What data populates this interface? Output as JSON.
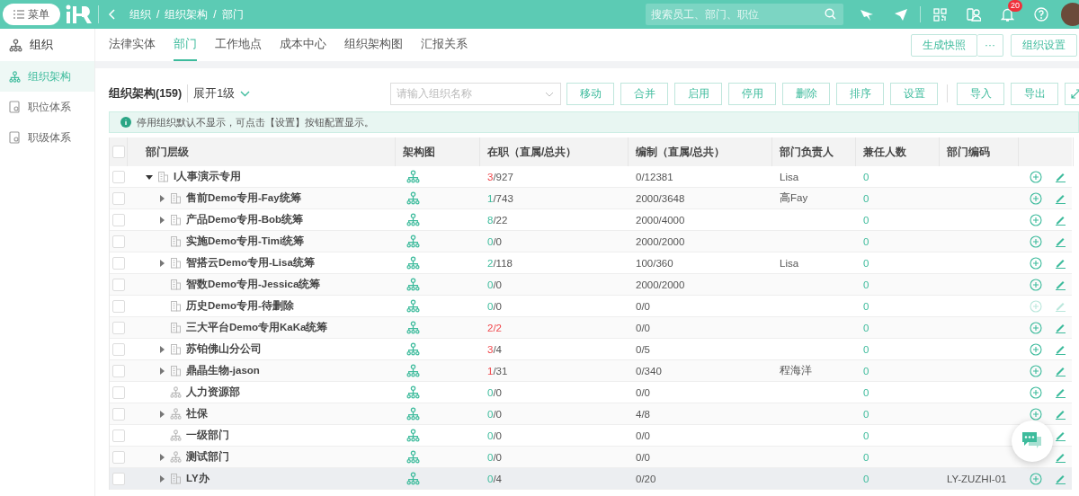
{
  "topbar": {
    "menu_label": "菜单",
    "breadcrumb": [
      "组织",
      "组织架构",
      "部门"
    ],
    "breadcrumb_separator": "/",
    "search": {
      "placeholder": "搜索员工、部门、职位"
    },
    "notification_count": "20"
  },
  "sidebar": {
    "title": "组织",
    "items": [
      {
        "label": "组织架构",
        "selected": true
      },
      {
        "label": "职位体系",
        "selected": false
      },
      {
        "label": "职级体系",
        "selected": false
      }
    ]
  },
  "tabs": [
    {
      "label": "法律实体",
      "selected": false
    },
    {
      "label": "部门",
      "selected": true
    },
    {
      "label": "工作地点",
      "selected": false
    },
    {
      "label": "成本中心",
      "selected": false
    },
    {
      "label": "组织架构图",
      "selected": false
    },
    {
      "label": "汇报关系",
      "selected": false
    }
  ],
  "header_buttons": {
    "snapshot": "生成快照",
    "more": "···",
    "settings": "组织设置"
  },
  "toolbar": {
    "title": "组织架构(159)",
    "expand_level": "展开1级",
    "org_select": {
      "placeholder": "请输入组织名称"
    },
    "actions": [
      "移动",
      "合并",
      "启用",
      "停用",
      "删除",
      "排序",
      "设置"
    ],
    "io": [
      "导入",
      "导出"
    ]
  },
  "notice": "停用组织默认不显示，可点击【设置】按钮配置显示。",
  "table": {
    "all_checked": false,
    "columns": [
      "部门层级",
      "架构图",
      "在职（直属/总共）",
      "编制（直属/总共）",
      "部门负责人",
      "兼任人数",
      "部门编码"
    ],
    "rows": [
      {
        "name": "I人事演示专用",
        "kind": "company",
        "expandable": true,
        "expanded": true,
        "direct": "3",
        "alert": true,
        "total": "/927",
        "total_alert": false,
        "quota": "0/12381",
        "head": "Lisa",
        "concurrent": "0",
        "checked": false,
        "disabled": false,
        "selected": false,
        "children": [
          {
            "name": "售前Demo专用-Fay统筹",
            "kind": "company",
            "expandable": true,
            "expanded": false,
            "direct": "1",
            "alert": false,
            "total": "/743",
            "total_alert": false,
            "quota": "2000/3648",
            "head": "高Fay",
            "concurrent": "0",
            "checked": false,
            "disabled": false,
            "selected": false
          },
          {
            "name": "产品Demo专用-Bob统筹",
            "kind": "company",
            "expandable": true,
            "expanded": false,
            "direct": "8",
            "alert": false,
            "total": "/22",
            "total_alert": false,
            "quota": "2000/4000",
            "concurrent": "0",
            "checked": false,
            "disabled": false,
            "selected": false
          },
          {
            "name": "实施Demo专用-Timi统筹",
            "kind": "company",
            "expandable": false,
            "direct": "0",
            "alert": false,
            "total": "/0",
            "total_alert": false,
            "quota": "2000/2000",
            "concurrent": "0",
            "checked": false,
            "disabled": false,
            "selected": false
          },
          {
            "name": "智搭云Demo专用-Lisa统筹",
            "kind": "company",
            "expandable": true,
            "expanded": false,
            "direct": "2",
            "alert": false,
            "total": "/118",
            "total_alert": false,
            "quota": "100/360",
            "head": "Lisa",
            "concurrent": "0",
            "checked": false,
            "disabled": false,
            "selected": false
          },
          {
            "name": "智数Demo专用-Jessica统筹",
            "kind": "company",
            "expandable": false,
            "direct": "0",
            "alert": false,
            "total": "/0",
            "total_alert": false,
            "quota": "2000/2000",
            "concurrent": "0",
            "checked": false,
            "disabled": false,
            "selected": false
          },
          {
            "name": "历史Demo专用-待删除",
            "kind": "company",
            "expandable": false,
            "direct": "0",
            "alert": false,
            "total": "/0",
            "total_alert": false,
            "quota": "0/0",
            "concurrent": "0",
            "checked": false,
            "disabled": true,
            "selected": false
          },
          {
            "name": "三大平台Demo专用KaKa统筹",
            "kind": "company",
            "expandable": false,
            "direct": "2",
            "alert": true,
            "total": "/2",
            "total_alert": true,
            "quota": "0/0",
            "concurrent": "0",
            "checked": false,
            "disabled": false,
            "selected": false
          },
          {
            "name": "苏铂佛山分公司",
            "kind": "company",
            "expandable": true,
            "expanded": false,
            "direct": "3",
            "alert": true,
            "total": "/4",
            "total_alert": false,
            "quota": "0/5",
            "concurrent": "0",
            "checked": false,
            "disabled": false,
            "selected": false
          },
          {
            "name": "鼎晶生物-jason",
            "kind": "company",
            "expandable": true,
            "expanded": false,
            "direct": "1",
            "alert": true,
            "total": "/31",
            "total_alert": false,
            "quota": "0/340",
            "head": "程海洋",
            "concurrent": "0",
            "checked": false,
            "disabled": false,
            "selected": false
          },
          {
            "name": "人力资源部",
            "kind": "department",
            "expandable": false,
            "direct": "0",
            "alert": false,
            "total": "/0",
            "total_alert": false,
            "quota": "0/0",
            "concurrent": "0",
            "checked": false,
            "disabled": false,
            "selected": false
          },
          {
            "name": "社保",
            "kind": "department",
            "expandable": true,
            "expanded": false,
            "direct": "0",
            "alert": false,
            "total": "/0",
            "total_alert": false,
            "quota": "4/8",
            "concurrent": "0",
            "checked": false,
            "disabled": false,
            "selected": false
          },
          {
            "name": "一级部门",
            "kind": "department",
            "expandable": false,
            "direct": "0",
            "alert": false,
            "total": "/0",
            "total_alert": false,
            "quota": "0/0",
            "concurrent": "0",
            "checked": false,
            "disabled": false,
            "selected": false
          },
          {
            "name": "测试部门",
            "kind": "department",
            "expandable": true,
            "expanded": false,
            "direct": "0",
            "alert": false,
            "total": "/0",
            "total_alert": false,
            "quota": "0/0",
            "concurrent": "0",
            "checked": false,
            "disabled": false,
            "selected": false
          },
          {
            "name": "LY办",
            "kind": "company",
            "expandable": true,
            "expanded": false,
            "direct": "0",
            "alert": false,
            "total": "/4",
            "total_alert": false,
            "quota": "0/20",
            "concurrent": "0",
            "code": "LY-ZUZHI-01",
            "checked": false,
            "disabled": false,
            "selected": true
          }
        ]
      }
    ]
  }
}
